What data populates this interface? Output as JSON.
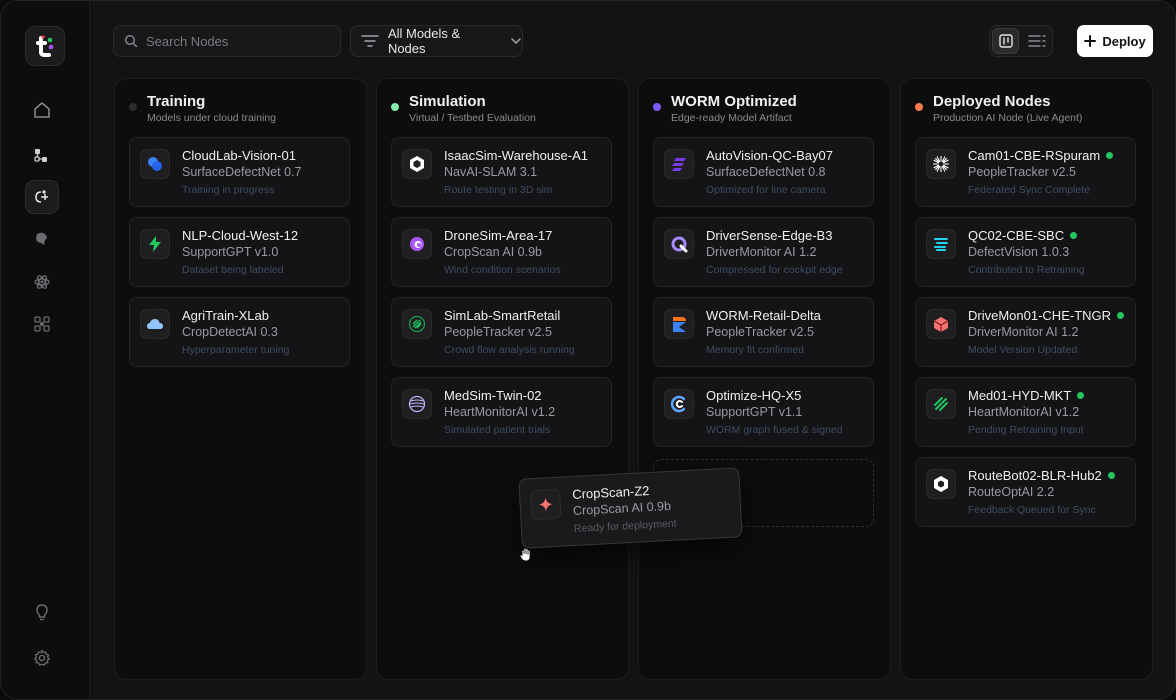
{
  "search": {
    "placeholder": "Search Nodes"
  },
  "filter": {
    "label": "All Models & Nodes"
  },
  "deploy": {
    "label": "Deploy"
  },
  "columns": [
    {
      "title": "Training",
      "subtitle": "Models under cloud training",
      "dot_color": "#2b2b2e",
      "cards": [
        {
          "name": "CloudLab-Vision-01",
          "model": "SurfaceDefectNet 0.7",
          "status": "Training in progress",
          "icon": "blue-blob-icon"
        },
        {
          "name": "NLP-Cloud-West-12",
          "model": "SupportGPT v1.0",
          "status": "Dataset being labeled",
          "icon": "green-bolt-icon"
        },
        {
          "name": "AgriTrain-XLab",
          "model": "CropDetectAI 0.3",
          "status": "Hyperparameter tuning",
          "icon": "cloud-icon"
        }
      ]
    },
    {
      "title": "Simulation",
      "subtitle": "Virtual / Testbed Evaluation",
      "dot_color": "#86efac",
      "cards": [
        {
          "name": "IsaacSim-Warehouse-A1",
          "model": "NavAI-SLAM 3.1",
          "status": "Route testing in 3D sim",
          "icon": "hexagon-icon"
        },
        {
          "name": "DroneSim-Area-17",
          "model": "CropScan AI 0.9b",
          "status": "Wind condition scenarios",
          "icon": "purple-swirl-icon"
        },
        {
          "name": "SimLab-SmartRetail",
          "model": "PeopleTracker v2.5",
          "status": "Crowd flow analysis running",
          "icon": "green-grid-icon"
        },
        {
          "name": "MedSim-Twin-02",
          "model": "HeartMonitorAI v1.2",
          "status": "Simulated patient trials",
          "icon": "striped-sphere-icon"
        }
      ]
    },
    {
      "title": "WORM Optimized",
      "subtitle": "Edge-ready Model Artifact",
      "dot_color": "#7c5cff",
      "cards": [
        {
          "name": "AutoVision-QC-Bay07",
          "model": "SurfaceDefectNet 0.8",
          "status": "Optimized for line camera",
          "icon": "purple-stripes-icon"
        },
        {
          "name": "DriverSense-Edge-B3",
          "model": "DriverMonitor AI 1.2",
          "status": "Compressed for cockpit edge",
          "icon": "q-ring-icon"
        },
        {
          "name": "WORM-Retail-Delta",
          "model": "PeopleTracker v2.5",
          "status": "Memory fit confirmed",
          "icon": "orange-blue-chevron-icon"
        },
        {
          "name": "Optimize-HQ-X5",
          "model": "SupportGPT v1.1",
          "status": "WORM graph fused & signed",
          "icon": "blue-c-icon"
        }
      ]
    },
    {
      "title": "Deployed Nodes",
      "subtitle": "Production AI Node (Live Agent)",
      "dot_color": "#fb7c4c",
      "cards": [
        {
          "name": "Cam01-CBE-RSpuram",
          "model": "PeopleTracker v2.5",
          "status": "Federated Sync Complete",
          "icon": "starburst-icon"
        },
        {
          "name": "QC02-CBE-SBC",
          "model": "DefectVision 1.0.3",
          "status": "Contributed to Retraining",
          "icon": "cyan-layers-icon"
        },
        {
          "name": "DriveMon01-CHE-TNGR",
          "model": "DriverMonitor AI 1.2",
          "status": "Model Version Updated",
          "icon": "red-cube-icon"
        },
        {
          "name": "Med01-HYD-MKT",
          "model": "HeartMonitorAI v1.2",
          "status": "Pending Retraining Input",
          "icon": "green-slash-icon"
        },
        {
          "name": "RouteBot02-BLR-Hub2",
          "model": "RouteOptAI 2.2",
          "status": "Feedback Queued for Sync",
          "icon": "white-hexagon-icon"
        }
      ]
    }
  ],
  "dragging_card": {
    "name": "CropScan-Z2",
    "model": "CropScan AI 0.9b",
    "status": "Ready for deployment",
    "icon": "red-sparkle-icon"
  }
}
